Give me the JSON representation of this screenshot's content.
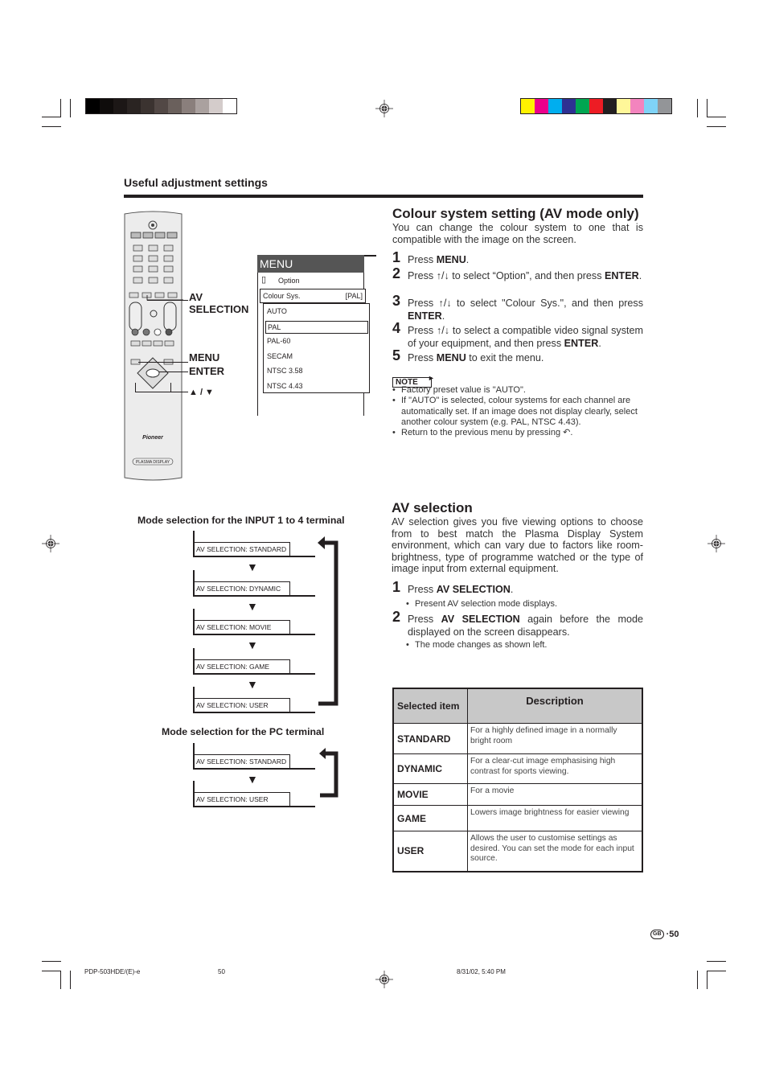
{
  "header": {
    "section_title": "Useful adjustment settings",
    "grayscale_colors": [
      "#000000",
      "#0f0c0b",
      "#1c1716",
      "#2a2422",
      "#3b3330",
      "#524845",
      "#6a605c",
      "#8a7f7c",
      "#aaa19f",
      "#d4cccb",
      "#ffffff"
    ],
    "process_colors": [
      "#fff200",
      "#ec008c",
      "#00aeef",
      "#2e3192",
      "#00a651",
      "#ed1c24",
      "#231f20",
      "#fff799",
      "#f384be",
      "#7fd3f7",
      "#939598"
    ]
  },
  "remote": {
    "brand": "Pioneer",
    "label": "PLASMA DISPLAY",
    "callouts": {
      "av_selection": "AV SELECTION",
      "menu": "MENU",
      "enter": "ENTER",
      "arrows": "↑ / ↓"
    }
  },
  "osd_menu": {
    "title": "MENU",
    "option_label": "Option",
    "colour_sys_label": "Colour Sys.",
    "colour_sys_value": "[PAL]",
    "items": [
      "AUTO",
      "PAL",
      "PAL-60",
      "SECAM",
      "NTSC 3.58",
      "NTSC 4.43"
    ],
    "selected": "PAL"
  },
  "colour_section": {
    "title": "Colour system setting (AV mode only)",
    "intro": "You can change the colour system to one that is compatible with the image on the screen.",
    "steps": [
      {
        "num": "1",
        "pre": "Press ",
        "bold": "MENU",
        "post": "."
      },
      {
        "num": "2",
        "pre": "Press ↑/↓ to select “Option”, and then press ",
        "bold": "ENTER",
        "post": "."
      },
      {
        "num": "3",
        "pre": "Press ↑/↓ to select \"Colour Sys.\", and then press ",
        "bold": "ENTER",
        "post": "."
      },
      {
        "num": "4",
        "pre": "Press ↑/↓ to select a compatible video signal system of your equipment, and then press ",
        "bold": "ENTER",
        "post": "."
      },
      {
        "num": "5",
        "pre": "Press ",
        "bold": "MENU",
        "post": " to exit the menu."
      }
    ],
    "note_label": "NOTE",
    "notes": [
      "Factory preset value is \"AUTO\".",
      "If \"AUTO\" is selected, colour systems for each channel are automatically set. If an image does not display clearly, select another colour system (e.g. PAL, NTSC 4.43).",
      "Return to the previous menu by pressing"
    ]
  },
  "av_section": {
    "title": "AV selection",
    "intro": "AV selection gives you five viewing options to choose from to best match the Plasma Display System environment, which can vary due to factors like room-brightness, type of programme watched or the type of image input from external equipment.",
    "step1": {
      "num": "1",
      "pre": "Press ",
      "bold": "AV SELECTION",
      "post": "."
    },
    "step1_bullet": "Present AV selection mode displays.",
    "step2": {
      "num": "2",
      "pre": "Press ",
      "bold": "AV SELECTION",
      "post": " again before the mode displayed on the screen disappears."
    },
    "step2_bullet": "The mode changes as shown left."
  },
  "flow_input": {
    "title": "Mode selection for the INPUT 1 to 4 terminal",
    "boxes": [
      "AV SELECTION: STANDARD",
      "AV SELECTION: DYNAMIC",
      "AV SELECTION: MOVIE",
      "AV SELECTION: GAME",
      "AV SELECTION: USER"
    ]
  },
  "flow_pc": {
    "title": "Mode selection for the PC terminal",
    "boxes": [
      "AV SELECTION: STANDARD",
      "AV SELECTION: USER"
    ]
  },
  "table": {
    "headers": [
      "Selected item",
      "Description"
    ],
    "rows": [
      {
        "item": "STANDARD",
        "desc": "For a highly defined image in a normally bright room"
      },
      {
        "item": "DYNAMIC",
        "desc": "For a clear-cut image emphasising high contrast for sports viewing."
      },
      {
        "item": "MOVIE",
        "desc": "For a movie"
      },
      {
        "item": "GAME",
        "desc": "Lowers image brightness for easier viewing"
      },
      {
        "item": "USER",
        "desc": "Allows the user to customise settings as desired. You can set the mode for each input source."
      }
    ]
  },
  "footer": {
    "region_badge": "GB",
    "page_number": "50",
    "doc_code": "PDP-503HDE/(E)-e",
    "file_page": "50",
    "timestamp": "8/31/02, 5:40 PM"
  }
}
